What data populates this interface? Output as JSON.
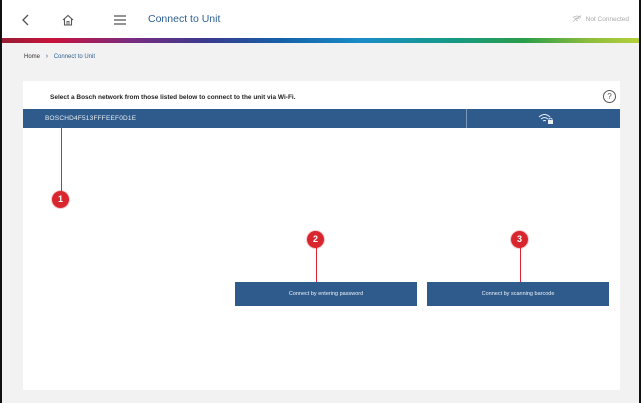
{
  "header": {
    "back_icon": "chevron-left-icon",
    "home_icon": "home-icon",
    "menu_icon": "menu-icon",
    "title": "Connect to Unit",
    "status": "Not Connected",
    "status_icon": "wifi-off-icon"
  },
  "breadcrumb": {
    "home": "Home",
    "current": "Connect to Unit"
  },
  "main": {
    "prompt": "Select a Bosch network from those listed below to connect to the unit via Wi-Fi.",
    "help_glyph": "?",
    "networks": [
      {
        "ssid": "BOSCHD4F513FFFEEF0D1E",
        "icon": "wifi-lock-icon"
      }
    ],
    "connect_password_label": "Connect by entering password",
    "connect_barcode_label": "Connect by scanning barcode"
  },
  "callouts": [
    "1",
    "2",
    "3"
  ],
  "colors": {
    "brand_blue": "#2e5b8c",
    "title_blue": "#2b5f93",
    "callout_red": "#d9262e",
    "background": "#f2f2f2"
  }
}
